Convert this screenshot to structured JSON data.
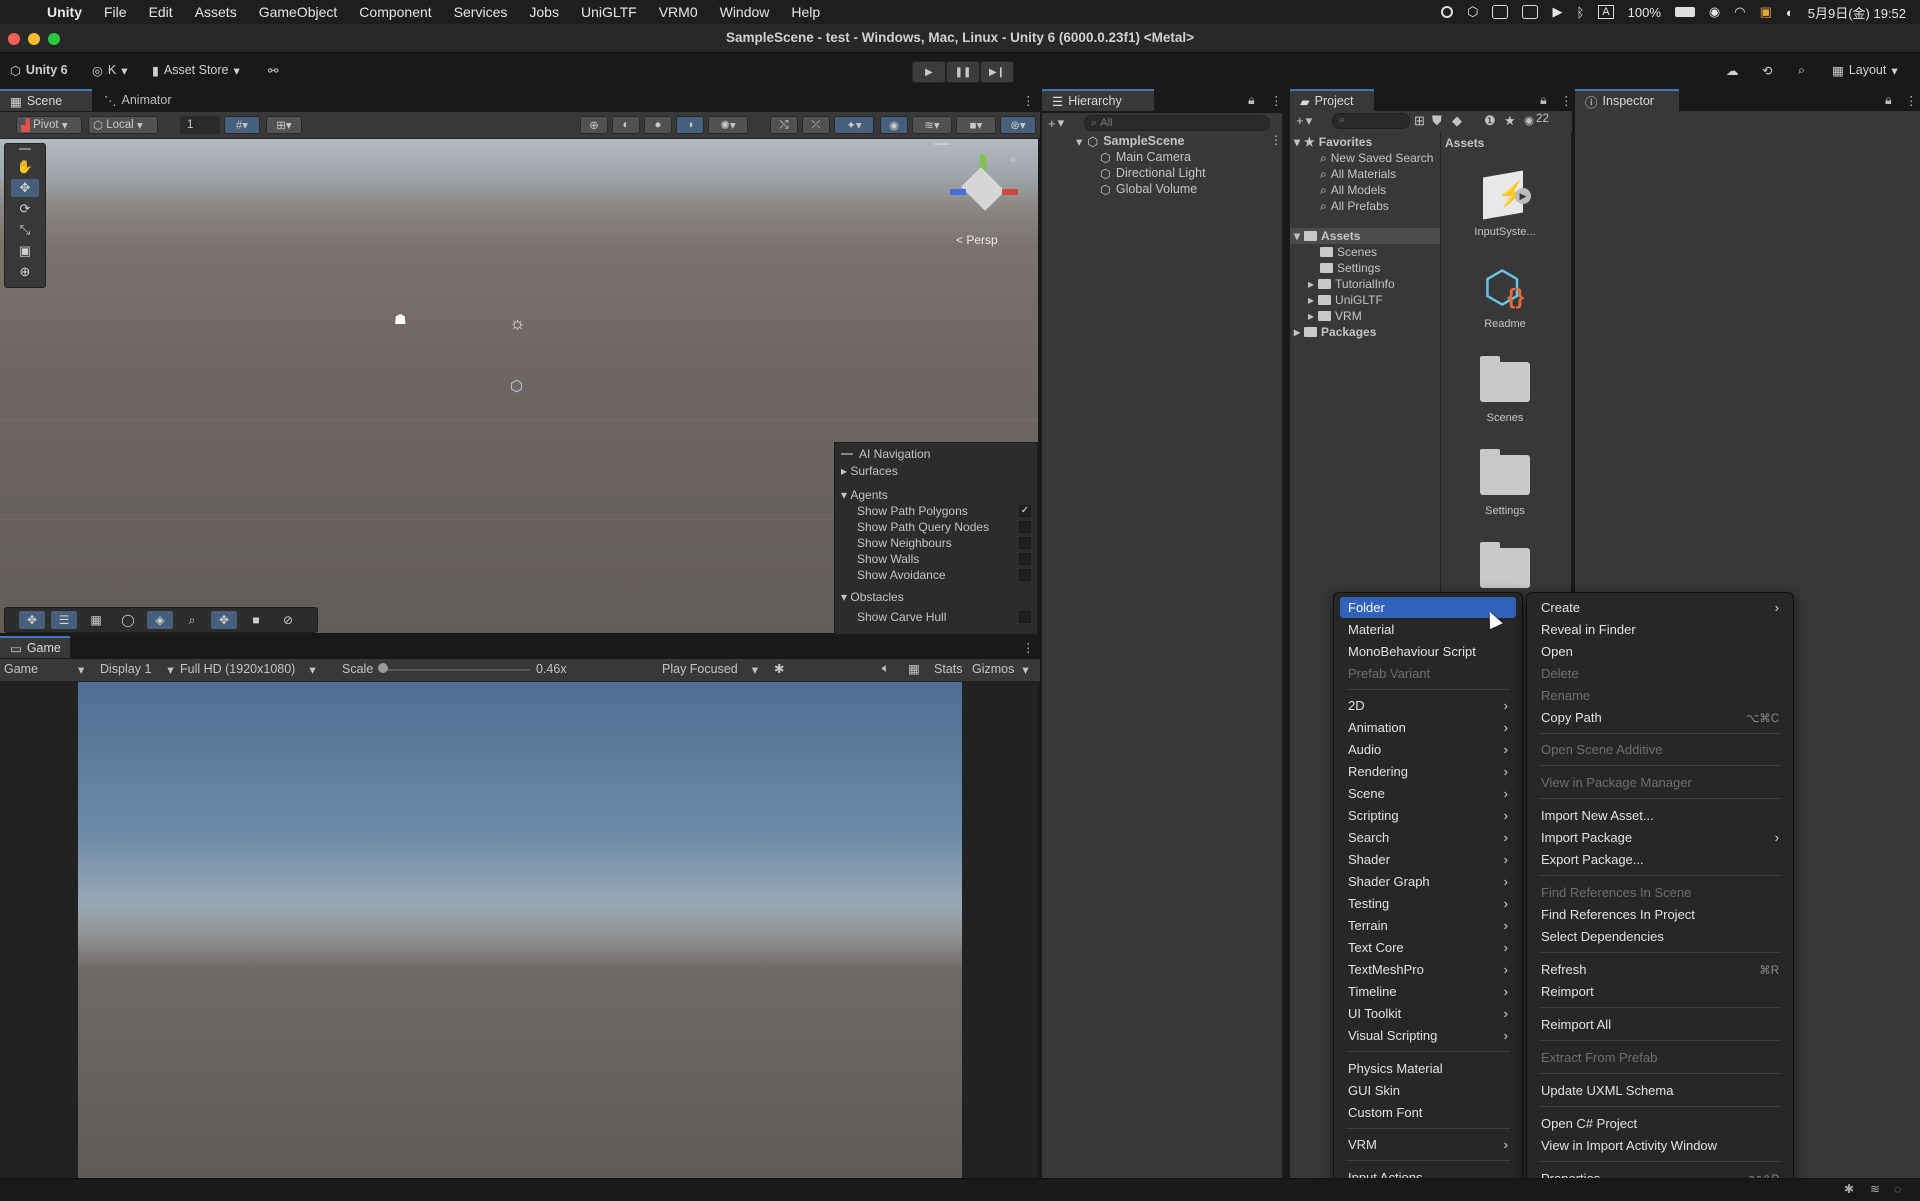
{
  "menubar": {
    "items": [
      "Unity",
      "File",
      "Edit",
      "Assets",
      "GameObject",
      "Component",
      "Services",
      "Jobs",
      "UniGLTF",
      "VRM0",
      "Window",
      "Help"
    ],
    "battery": "100%",
    "input_mode": "A",
    "datetime": "5月9日(金)  19:52"
  },
  "window": {
    "title": "SampleScene - test - Windows, Mac, Linux - Unity 6 (6000.0.23f1) <Metal>"
  },
  "toolbar": {
    "unity_label": "Unity 6",
    "account": "K",
    "asset_store": "Asset Store",
    "layout": "Layout"
  },
  "scene_panel": {
    "tabs": [
      "Scene",
      "Animator"
    ],
    "pivot": "Pivot",
    "local": "Local",
    "grid_snap": "1",
    "persp": "< Persp"
  },
  "ai_navigation": {
    "title": "AI Navigation",
    "surfaces": "Surfaces",
    "agents": "Agents",
    "agent_options": [
      {
        "label": "Show Path Polygons",
        "checked": true
      },
      {
        "label": "Show Path Query Nodes",
        "checked": false
      },
      {
        "label": "Show Neighbours",
        "checked": false
      },
      {
        "label": "Show Walls",
        "checked": false
      },
      {
        "label": "Show Avoidance",
        "checked": false
      }
    ],
    "obstacles": "Obstacles",
    "obstacle_options": [
      {
        "label": "Show Carve Hull",
        "checked": false
      }
    ]
  },
  "game_panel": {
    "tab": "Game",
    "mode": "Game",
    "display": "Display 1",
    "resolution": "Full HD (1920x1080)",
    "scale_label": "Scale",
    "scale_value": "0.46x",
    "scale_level": 0.0,
    "play_focused": "Play Focused",
    "stats": "Stats",
    "gizmos": "Gizmos"
  },
  "hierarchy": {
    "tab": "Hierarchy",
    "search_placeholder": "All",
    "scene": "SampleScene",
    "objects": [
      "Main Camera",
      "Directional Light",
      "Global Volume"
    ]
  },
  "project": {
    "tab": "Project",
    "hidden_count": "22",
    "favorites_label": "Favorites",
    "favorites": [
      "New Saved Search",
      "All Materials",
      "All Models",
      "All Prefabs"
    ],
    "assets_label": "Assets",
    "asset_folders": [
      "Scenes",
      "Settings",
      "TutorialInfo",
      "UniGLTF",
      "VRM"
    ],
    "packages_label": "Packages",
    "grid_header": "Assets",
    "grid_items": [
      "InputSyste...",
      "Readme",
      "Scenes",
      "Settings"
    ]
  },
  "inspector": {
    "tab": "Inspector"
  },
  "context_menu": {
    "items": [
      {
        "label": "Create",
        "submenu": true
      },
      {
        "label": "Reveal in Finder"
      },
      {
        "label": "Open"
      },
      {
        "label": "Delete",
        "disabled": true
      },
      {
        "label": "Rename",
        "disabled": true
      },
      {
        "label": "Copy Path",
        "shortcut": "⌥⌘C"
      },
      {
        "label": "Open Scene Additive",
        "disabled": true
      },
      {
        "label": "View in Package Manager",
        "disabled": true
      },
      {
        "label": "Import New Asset..."
      },
      {
        "label": "Import Package",
        "submenu": true
      },
      {
        "label": "Export Package..."
      },
      {
        "label": "Find References In Scene",
        "disabled": true
      },
      {
        "label": "Find References In Project"
      },
      {
        "label": "Select Dependencies"
      },
      {
        "label": "Refresh",
        "shortcut": "⌘R"
      },
      {
        "label": "Reimport"
      },
      {
        "label": "Reimport All"
      },
      {
        "label": "Extract From Prefab",
        "disabled": true
      },
      {
        "label": "Update UXML Schema"
      },
      {
        "label": "Open C# Project"
      },
      {
        "label": "View in Import Activity Window"
      },
      {
        "label": "Properties...",
        "shortcut": "⌥⇧P"
      }
    ]
  },
  "create_submenu": {
    "items": [
      {
        "label": "Folder",
        "highlighted": true
      },
      {
        "label": "Material"
      },
      {
        "label": "MonoBehaviour Script"
      },
      {
        "label": "Prefab Variant",
        "disabled": true
      },
      {
        "label": "2D",
        "submenu": true
      },
      {
        "label": "Animation",
        "submenu": true
      },
      {
        "label": "Audio",
        "submenu": true
      },
      {
        "label": "Rendering",
        "submenu": true
      },
      {
        "label": "Scene",
        "submenu": true
      },
      {
        "label": "Scripting",
        "submenu": true
      },
      {
        "label": "Search",
        "submenu": true
      },
      {
        "label": "Shader",
        "submenu": true
      },
      {
        "label": "Shader Graph",
        "submenu": true
      },
      {
        "label": "Testing",
        "submenu": true
      },
      {
        "label": "Terrain",
        "submenu": true
      },
      {
        "label": "Text Core",
        "submenu": true
      },
      {
        "label": "TextMeshPro",
        "submenu": true
      },
      {
        "label": "Timeline",
        "submenu": true
      },
      {
        "label": "UI Toolkit",
        "submenu": true
      },
      {
        "label": "Visual Scripting",
        "submenu": true
      },
      {
        "label": "Physics Material"
      },
      {
        "label": "GUI Skin"
      },
      {
        "label": "Custom Font"
      },
      {
        "label": "VRM",
        "submenu": true
      },
      {
        "label": "Input Actions"
      }
    ]
  },
  "colors": {
    "accent": "#3a79bb",
    "highlight": "#2f62b8",
    "panel": "#383838",
    "menu_bg": "#272727"
  }
}
